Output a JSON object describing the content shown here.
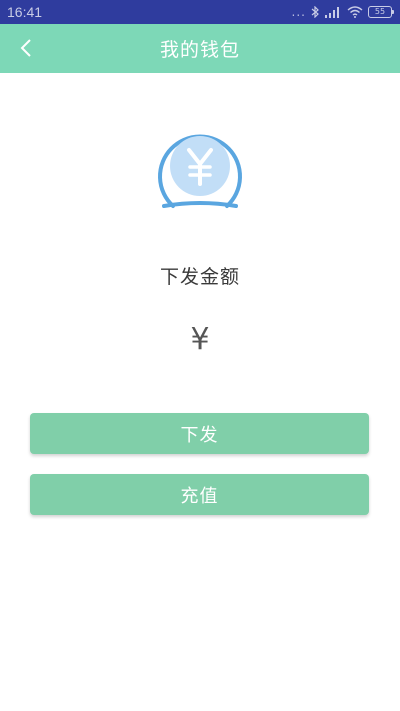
{
  "status_bar": {
    "time": "16:41",
    "dots": "...",
    "battery": "55"
  },
  "header": {
    "title": "我的钱包",
    "back_icon": "chevron-left-icon"
  },
  "wallet": {
    "icon": "yen-coin-icon",
    "amount_label": "下发金额",
    "amount_value": "¥"
  },
  "actions": {
    "issue_label": "下发",
    "recharge_label": "充值"
  },
  "colors": {
    "status_bar": "#2f3c9e",
    "app_bar": "#7dd8b7",
    "button": "#80cfa9",
    "icon_ring": "#5aa6e0",
    "icon_fill": "#c2def7"
  }
}
